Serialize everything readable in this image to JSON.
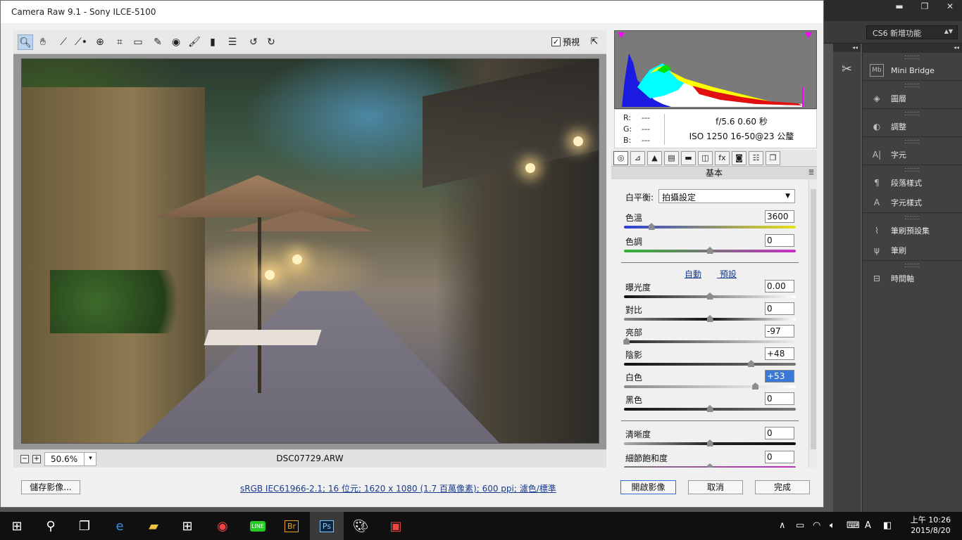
{
  "dialog": {
    "title": "Camera Raw 9.1  -  Sony ILCE-5100"
  },
  "toolbar": {
    "tools": [
      "zoom-icon",
      "hand-icon",
      "white-balance-icon",
      "color-sampler-icon",
      "target-adjust-icon",
      "crop-icon",
      "straighten-icon",
      "spot-removal-icon",
      "red-eye-icon",
      "adjustment-brush-icon",
      "graduated-filter-icon",
      "preferences-icon",
      "rotate-left-icon",
      "rotate-right-icon"
    ],
    "preview_label": "預視",
    "preview_checked": "✓"
  },
  "status": {
    "zoom": "50.6%",
    "filename": "DSC07729.ARW"
  },
  "info": {
    "r_label": "R:",
    "g_label": "G:",
    "b_label": "B:",
    "r": "---",
    "g": "---",
    "b": "---",
    "line1": "f/5.6    0.60 秒",
    "line2": "ISO 1250    16-50@23 公釐"
  },
  "panel": {
    "title": "基本",
    "wb_label": "白平衡:",
    "wb_value": "拍攝設定",
    "links": {
      "auto": "自動",
      "default": "預設"
    },
    "sliders": [
      {
        "label": "色溫",
        "value": "3600",
        "level": 0.16
      },
      {
        "label": "色調",
        "value": "0",
        "level": 0.5
      },
      {
        "label": "曝光度",
        "value": "0.00",
        "level": 0.5
      },
      {
        "label": "對比",
        "value": "0",
        "level": 0.5
      },
      {
        "label": "亮部",
        "value": "-97",
        "level": 0.015
      },
      {
        "label": "陰影",
        "value": "+48",
        "level": 0.74
      },
      {
        "label": "白色",
        "value": "+53",
        "level": 0.765
      },
      {
        "label": "黑色",
        "value": "0",
        "level": 0.5
      },
      {
        "label": "清晰度",
        "value": "0",
        "level": 0.5
      },
      {
        "label": "細節飽和度",
        "value": "0",
        "level": 0.5
      }
    ]
  },
  "buttons": {
    "save": "儲存影像...",
    "open": "開啟影像",
    "cancel": "取消",
    "done": "完成"
  },
  "workflow": "sRGB IEC61966-2.1; 16 位元; 1620 x 1080 (1.7 百萬像素); 600 ppi; 濾色/標準",
  "photoshop": {
    "workspace": "CS6 新增功能",
    "panels": [
      "Mini Bridge",
      "圖層",
      "調整",
      "字元",
      "段落樣式",
      "字元樣式",
      "筆刷預設集",
      "筆刷",
      "時間軸"
    ]
  },
  "taskbar": {
    "time": "上午 10:26",
    "date": "2015/8/20",
    "ime": "A",
    "apps": [
      "start-icon",
      "search-icon",
      "task-view-icon",
      "edge-icon",
      "file-explorer-icon",
      "store-icon",
      "chrome-icon",
      "line-icon",
      "bridge-icon",
      "photoshop-icon",
      "paint-icon",
      "photo-viewer-icon"
    ],
    "app_labels": {
      "bridge": "Br",
      "photoshop": "Ps",
      "line": "LINE"
    }
  }
}
